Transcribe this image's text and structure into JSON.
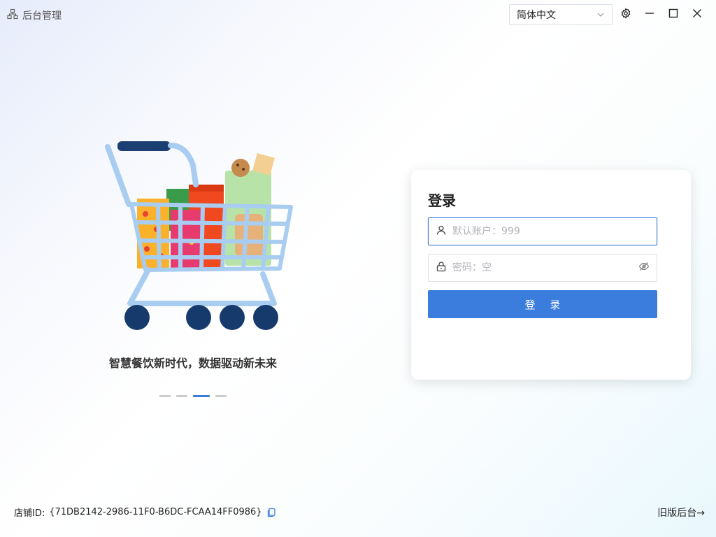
{
  "app": {
    "title": "后台管理"
  },
  "language": {
    "selected": "简体中文"
  },
  "carousel": {
    "slogan": "智慧餐饮新时代，数据驱动新未来",
    "dot_count": 4,
    "active_index": 2
  },
  "login": {
    "title": "登录",
    "account_placeholder": "默认账户：999",
    "password_placeholder": "密码：空",
    "submit_label": "登 录"
  },
  "footer": {
    "store_label": "店铺ID:",
    "store_id": "{71DB2142-2986-11F0-B6DC-FCAA14FF0986}",
    "old_admin_link": "旧版后台→"
  },
  "colors": {
    "accent": "#3b7ddd",
    "cart_frame": "#a9cdf0",
    "wheel": "#163a6b"
  },
  "icons": {
    "app": "sitemap-icon",
    "language": "chevron-down-icon",
    "settings": "gear-icon",
    "minimize": "minimize-icon",
    "maximize": "maximize-icon",
    "close": "close-icon",
    "account": "user-icon",
    "password": "lock-icon",
    "toggle_password": "eye-off-icon",
    "copy": "copy-icon"
  }
}
